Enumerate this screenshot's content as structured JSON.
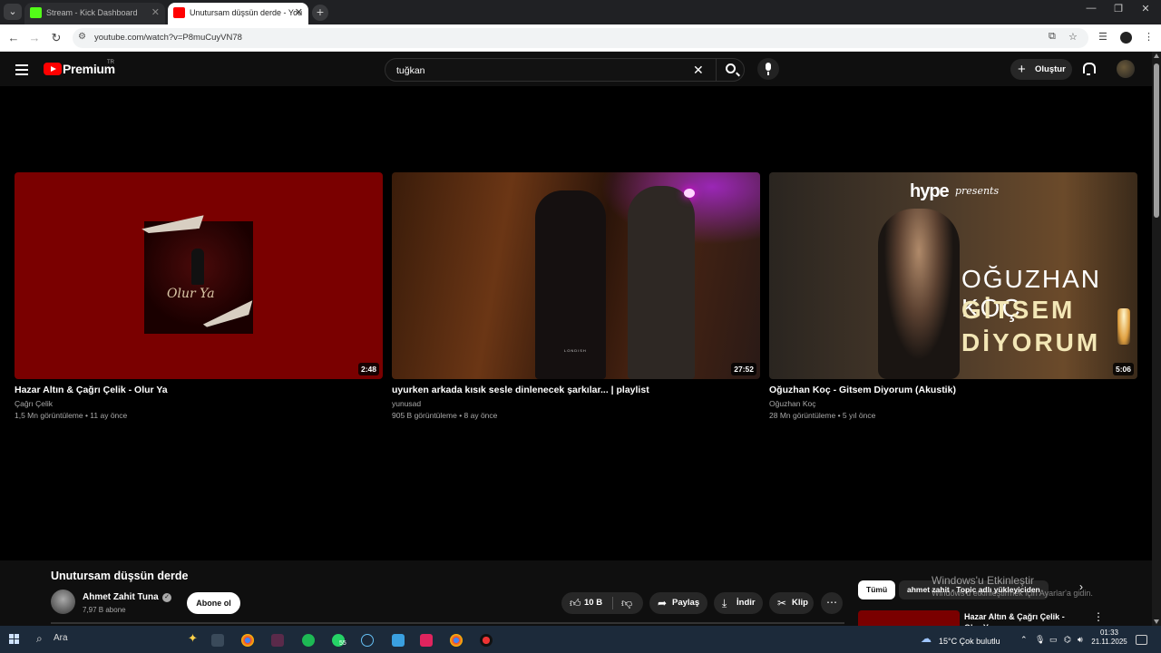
{
  "browser": {
    "tabs": [
      {
        "title": "Stream - Kick Dashboard",
        "active": false
      },
      {
        "title": "Unutursam düşsün derde - You",
        "active": true
      }
    ],
    "url": "youtube.com/watch?v=P8muCuyVN78",
    "new_tab_symbol": "+",
    "close_symbol": "✕"
  },
  "yt": {
    "logo": "Premium",
    "logo_region": "TR",
    "search_value": "tuğkan",
    "create_label": "Oluştur"
  },
  "videos": [
    {
      "title": "Hazar Altın & Çağrı Çelik - Olur Ya",
      "channel": "Çağrı Çelik",
      "meta": "1,5 Mn görüntüleme • 11 ay önce",
      "duration": "2:48",
      "thumb_caption": "Olur Ya"
    },
    {
      "title": "uyurken arkada kısık sesle dinlenecek şarkılar... | playlist",
      "channel": "yunusad",
      "meta": "905 B görüntüleme • 8 ay önce",
      "duration": "27:52",
      "thumb_caption": "LONDISH"
    },
    {
      "title": "Oğuzhan Koç - Gitsem Diyorum (Akustik)",
      "channel": "Oğuzhan Koç",
      "meta": "28 Mn görüntüleme • 5 yıl önce",
      "duration": "5:06",
      "thumb_brand": "hype",
      "thumb_presents": "presents",
      "thumb_line1": "OĞUZHAN KOÇ",
      "thumb_line2": "GİTSEM",
      "thumb_line3": "DİYORUM"
    }
  ],
  "player": {
    "title": "Unutursam düşsün derde",
    "channel": "Ahmet Zahit Tuna",
    "subscribers": "7,97 B abone",
    "subscribe_label": "Abone ol",
    "likes": "10 B",
    "share_label": "Paylaş",
    "download_label": "İndir",
    "clip_label": "Klip"
  },
  "sidebar": {
    "chips": [
      "Tümü",
      "ahmet zahit - Topic adlı yükleyiciden"
    ],
    "watermark_line1": "Windows'u Etkinleştir",
    "watermark_line2": "Windows'u etkinleştirmek için Ayarlar'a gidin.",
    "rec_title": "Hazar Altın & Çağrı Çelik - Olur Ya"
  },
  "taskbar": {
    "search_label": "Ara",
    "weather": "15°C  Çok bulutlu",
    "time": "01:33",
    "date": "21.11.2025",
    "badge": "55"
  },
  "colors": {
    "brand_red": "#ff0000",
    "background": "#0f0f0f",
    "chip_bg": "#272727"
  }
}
